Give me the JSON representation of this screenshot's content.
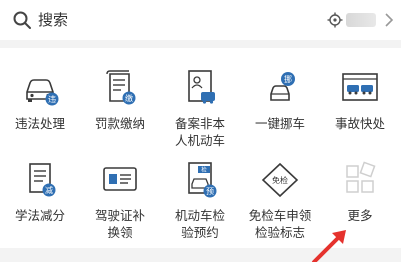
{
  "search": {
    "label": "搜索"
  },
  "services_row1": [
    {
      "label": "违法处理",
      "icon": "car-violation-icon",
      "badge": "违"
    },
    {
      "label": "罚款缴纳",
      "icon": "fine-payment-icon",
      "badge": "缴"
    },
    {
      "label": "备案非本\n人机动车",
      "icon": "vehicle-filing-icon",
      "badge": ""
    },
    {
      "label": "一键挪车",
      "icon": "move-car-icon",
      "badge": "挪"
    },
    {
      "label": "事故快处",
      "icon": "accident-icon",
      "badge": ""
    }
  ],
  "services_row2": [
    {
      "label": "学法减分",
      "icon": "study-law-icon",
      "badge": "减"
    },
    {
      "label": "驾驶证补\n换领",
      "icon": "license-renew-icon",
      "badge": ""
    },
    {
      "label": "机动车检\n验预约",
      "icon": "inspection-booking-icon",
      "badge": "预",
      "tag": "检"
    },
    {
      "label": "免检车申领\n检验标志",
      "icon": "exempt-sticker-icon",
      "badge": "免检"
    },
    {
      "label": "更多",
      "icon": "more-grid-icon",
      "badge": ""
    }
  ],
  "colors": {
    "icon_blue": "#2f6fb3",
    "icon_outline": "#3a3a3a",
    "more_gray": "#cfcfcf",
    "arrow_red": "#e5322d"
  }
}
